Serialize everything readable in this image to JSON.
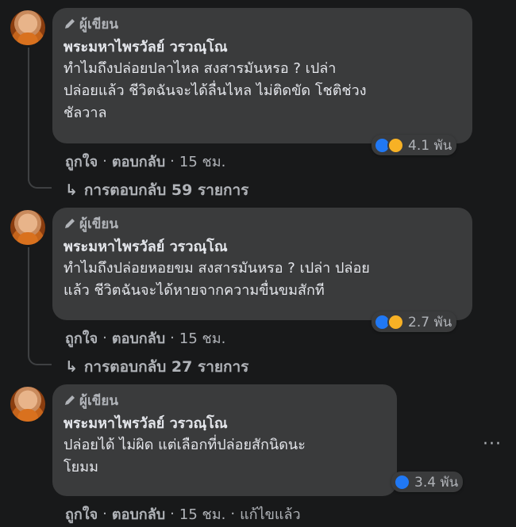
{
  "comments": [
    {
      "badge": "ผู้เขียน",
      "author": "พระมหาไพรวัลย์ วรวณฺโณ",
      "text_lines": [
        "ทำไมถึงปล่อยปลาไหล สงสารมันหรอ ? เปล่า",
        "ปล่อยแล้ว ชีวิตฉันจะได้ลื่นไหล ไม่ติดขัด โชติช่วง",
        "ชัลวาล"
      ],
      "reactions": [
        "like-icon",
        "haha-icon"
      ],
      "reaction_count": "4.1 พัน",
      "like_label": "ถูกใจ",
      "reply_label": "ตอบกลับ",
      "time": "15 ชม.",
      "replies_label": "การตอบกลับ 59 รายการ"
    },
    {
      "badge": "ผู้เขียน",
      "author": "พระมหาไพรวัลย์ วรวณฺโณ",
      "text_lines": [
        "ทำไมถึงปล่อยหอยขม สงสารมันหรอ ? เปล่า ปล่อย",
        "แล้ว ชีวิตฉันจะได้หายจากความขื่นขมสักที"
      ],
      "reactions": [
        "like-icon",
        "haha-icon"
      ],
      "reaction_count": "2.7 พัน",
      "like_label": "ถูกใจ",
      "reply_label": "ตอบกลับ",
      "time": "15 ชม.",
      "replies_label": "การตอบกลับ 27 รายการ"
    },
    {
      "badge": "ผู้เขียน",
      "author": "พระมหาไพรวัลย์ วรวณฺโณ",
      "text_lines": [
        "ปล่อยได้ ไม่ผิด แต่เลือกที่ปล่อยสักนิดนะ",
        "โยมม"
      ],
      "reactions": [
        "like-icon"
      ],
      "reaction_count": "3.4 พัน",
      "like_label": "ถูกใจ",
      "reply_label": "ตอบกลับ",
      "time": "15 ชม.",
      "edited_label": "แก้ไขแล้ว",
      "more_label": "···"
    }
  ],
  "colors": {
    "background": "#18191a",
    "bubble": "#3a3b3c",
    "like": "#2078f4",
    "haha": "#f7b125"
  }
}
